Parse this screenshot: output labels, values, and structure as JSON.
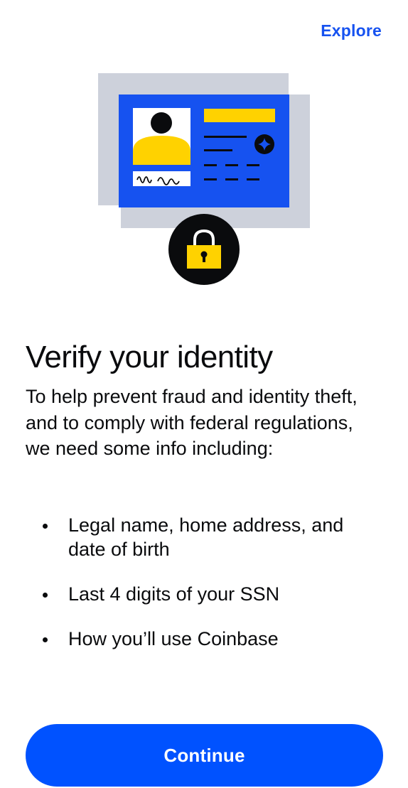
{
  "header": {
    "explore_label": "Explore"
  },
  "illustration": {
    "icons": [
      "id-card-icon",
      "avatar-icon",
      "signature-icon",
      "star-badge-icon",
      "lock-icon"
    ],
    "colors": {
      "card_blue": "#1652f0",
      "card_shadow": "#cdd1db",
      "accent_yellow": "#ffd200",
      "dark": "#0a0b0d"
    }
  },
  "main": {
    "title": "Verify your identity",
    "intro": "To help prevent fraud and identity theft, and to comply with federal regulations, we need some info including:",
    "requirements": [
      "Legal name, home address, and date of birth",
      "Last 4 digits of your SSN",
      "How you’ll use Coinbase"
    ]
  },
  "footer": {
    "continue_label": "Continue"
  },
  "colors": {
    "primary": "#0052ff",
    "link": "#1652f0",
    "text": "#0a0b0d"
  }
}
